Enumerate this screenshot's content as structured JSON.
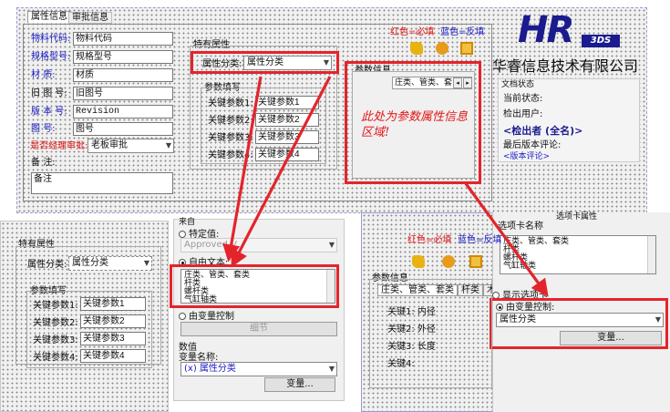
{
  "top": {
    "tabs": [
      "属性信息",
      "审批信息"
    ],
    "legend_required": "红色=必填",
    "legend_readonly": "蓝色=反填",
    "fields": [
      {
        "label": "物料代码:",
        "value": "物料代码"
      },
      {
        "label": "规格型号:",
        "value": "规格型号"
      },
      {
        "label": "材    质:",
        "value": "材质"
      },
      {
        "label": "旧 图 号:",
        "value": "旧图号"
      },
      {
        "label": "版 本 号:",
        "value": "Revision"
      },
      {
        "label": "图    号:",
        "value": "图号"
      }
    ],
    "approval_label": "是否经理审批:",
    "approval_value": "老板审批",
    "remark_label": "备    注:",
    "remark_value": "备注",
    "special_title": "特有属性",
    "category_label": "属性分类:",
    "category_value": "属性分类",
    "param_fill_title": "参数填写",
    "params": [
      {
        "label": "关键参数1:",
        "value": "关键参数1"
      },
      {
        "label": "关键参数2:",
        "value": "关键参数2"
      },
      {
        "label": "关键参数3:",
        "value": "关键参数3"
      },
      {
        "label": "关键参数4:",
        "value": "关键参数4"
      }
    ],
    "param_info_title": "参数信息",
    "param_info_tabs": "庄类、管类、套",
    "param_area_note": "此处为参数属性信息区域!",
    "logo_text": "HR",
    "logo_sub": "3DS",
    "company": "华睿信息技术有限公司",
    "doc_status": "文档状态",
    "current_status": "当前状态:",
    "checked_out_user": "检出用户:",
    "checked_out_by": "<检出者 (全名)>",
    "latest_comment": "最后版本评论:",
    "version_comment": "<版本评论>"
  },
  "bottom_left": {
    "special_title": "特有属性",
    "category_label": "属性分类:",
    "category_value": "属性分类",
    "param_fill_title": "参数填写",
    "params": [
      {
        "label": "关键参数1:",
        "value": "关键参数1"
      },
      {
        "label": "关键参数2:",
        "value": "关键参数2"
      },
      {
        "label": "关键参数3:",
        "value": "关键参数3"
      },
      {
        "label": "关键参数4:",
        "value": "关键参数4"
      }
    ]
  },
  "bottom_mid": {
    "group_header": "来自",
    "specific_value_label": "特定值:",
    "specific_value_placeholder": "Approved V",
    "from_text_label": "自由文本:",
    "list_items": [
      "庄类、管类、套类",
      "杆类",
      "螺杆类",
      "气缸轴类"
    ],
    "controlled_label": "由变量控制",
    "details_button": "细节",
    "value_header": "数值",
    "variable_label": "变量名称:",
    "variable_value": "(x) 属性分类",
    "variable_button": "变量..."
  },
  "bottom_right": {
    "panel_title": "选项卡属性",
    "tab_name_label": "选项卡名称",
    "tab_list": [
      "庄类、管类、套类",
      "杆类",
      "螺杆类",
      "气缸轴类"
    ],
    "legend_required": "红色=必填",
    "legend_readonly": "蓝色=反填",
    "param_info_title": "参数信息",
    "param_tabs": [
      "庄类、管类、套类",
      "杆类",
      "木"
    ],
    "keys": [
      "关键1: 内径",
      "关键2: 外径",
      "关键3: 长度",
      "关键4:"
    ],
    "show_tab_label": "显示选项卡",
    "controlled_label": "由变量控制:",
    "controlled_value": "属性分类",
    "variable_button": "变量..."
  },
  "colors": {
    "arrow_red": "#e4242b",
    "logo_blue": "#1b1b8f",
    "label_blue": "#1b1bc8",
    "label_red": "#e31414"
  }
}
